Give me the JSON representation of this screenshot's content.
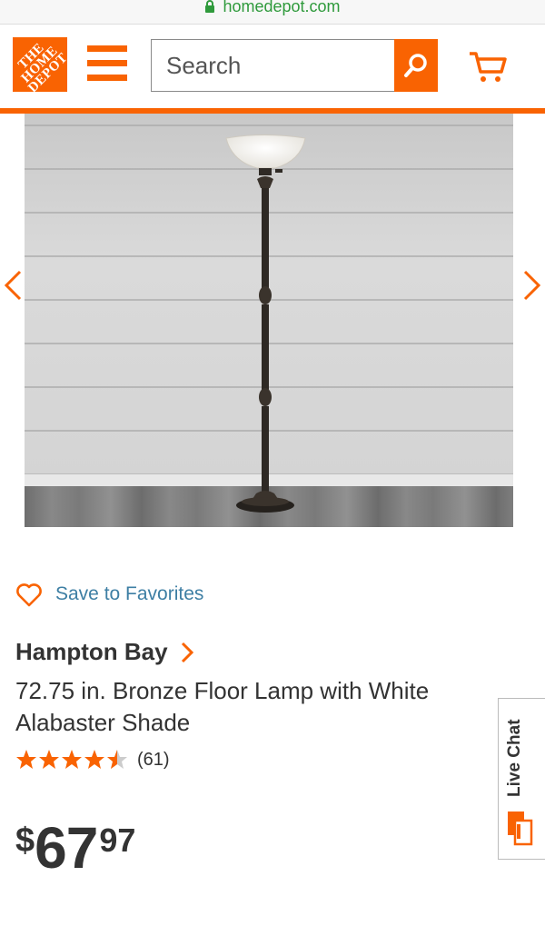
{
  "browser": {
    "url": "homedepot.com"
  },
  "header": {
    "logo_text": "THE HOME DEPOT",
    "search_placeholder": "Search"
  },
  "colors": {
    "brand_orange": "#f96302",
    "link_blue": "#3e7fa4",
    "url_green": "#2f9a3c"
  },
  "icons": [
    "lock-icon",
    "menu-icon",
    "search-icon",
    "cart-icon",
    "chevron-left-icon",
    "chevron-right-icon",
    "heart-icon",
    "chevron-right-icon",
    "star-icon",
    "chat-icon"
  ],
  "product": {
    "save_label": "Save to Favorites",
    "brand": "Hampton Bay",
    "title": "72.75 in. Bronze Floor Lamp with White Alabaster Shade",
    "rating": 4.5,
    "review_count": "(61)",
    "price": {
      "currency": "$",
      "dollars": "67",
      "cents": "97"
    }
  },
  "live_chat": {
    "label": "Live Chat"
  }
}
